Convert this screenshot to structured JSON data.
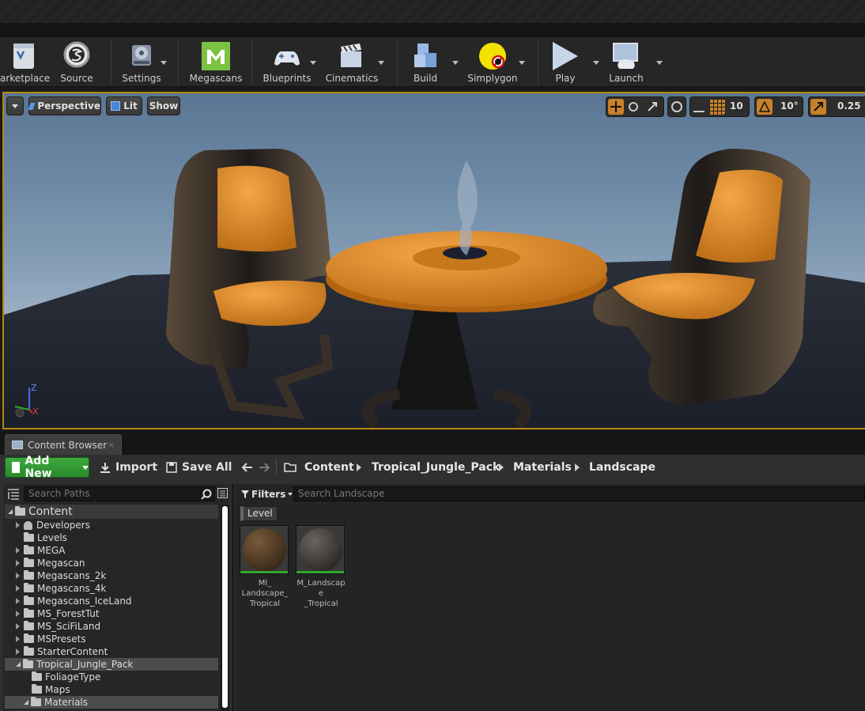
{
  "toolbar": {
    "items": [
      {
        "label": "arketplace",
        "icon": "marketplace-icon"
      },
      {
        "label": "Source",
        "icon": "source-control-icon"
      },
      {
        "label": "Settings",
        "icon": "settings-icon"
      },
      {
        "label": "Megascans",
        "icon": "megascans-icon"
      },
      {
        "label": "Blueprints",
        "icon": "blueprints-icon"
      },
      {
        "label": "Cinematics",
        "icon": "cinematics-icon"
      },
      {
        "label": "Build",
        "icon": "build-icon"
      },
      {
        "label": "Simplygon",
        "icon": "simplygon-icon"
      },
      {
        "label": "Play",
        "icon": "play-icon"
      },
      {
        "label": "Launch",
        "icon": "launch-icon"
      }
    ]
  },
  "viewport": {
    "perspective_label": "Perspective",
    "lit_label": "Lit",
    "show_label": "Show",
    "grid_snap_value": "10",
    "rotation_snap_value": "10°",
    "scale_snap_value": "0.25",
    "axis_labels": {
      "z": "Z",
      "x": "X"
    }
  },
  "content_browser": {
    "tab_label": "Content Browser",
    "tab_close": "×",
    "add_new_label": "Add New",
    "import_label": "Import",
    "save_all_label": "Save All",
    "breadcrumbs": [
      "Content",
      "Tropical_Jungle_Pack",
      "Materials",
      "Landscape"
    ],
    "search_paths_placeholder": "Search Paths",
    "filters_label": "Filters",
    "search_assets_placeholder": "Search Landscape",
    "filter_chip": "Level",
    "tree": [
      {
        "label": "Content",
        "depth": 0,
        "expanded": true,
        "root": true
      },
      {
        "label": "Developers",
        "depth": 1,
        "expanded": false,
        "icon": "user"
      },
      {
        "label": "Levels",
        "depth": 1,
        "expanded": null
      },
      {
        "label": "MEGA",
        "depth": 1,
        "expanded": false
      },
      {
        "label": "Megascan",
        "depth": 1,
        "expanded": false
      },
      {
        "label": "Megascans_2k",
        "depth": 1,
        "expanded": false
      },
      {
        "label": "Megascans_4k",
        "depth": 1,
        "expanded": false
      },
      {
        "label": "Megascans_IceLand",
        "depth": 1,
        "expanded": false
      },
      {
        "label": "MS_ForestTut",
        "depth": 1,
        "expanded": false
      },
      {
        "label": "MS_SciFiLand",
        "depth": 1,
        "expanded": false
      },
      {
        "label": "MSPresets",
        "depth": 1,
        "expanded": false
      },
      {
        "label": "StarterContent",
        "depth": 1,
        "expanded": false
      },
      {
        "label": "Tropical_Jungle_Pack",
        "depth": 1,
        "expanded": true,
        "selected": true
      },
      {
        "label": "FoliageType",
        "depth": 2,
        "expanded": null
      },
      {
        "label": "Maps",
        "depth": 2,
        "expanded": null
      },
      {
        "label": "Materials",
        "depth": 2,
        "expanded": true,
        "selected": true
      }
    ],
    "assets": [
      {
        "name": "MI_\nLandscape_\nTropical",
        "color_a": "#7a5a3a",
        "color_b": "#3a2a1a"
      },
      {
        "name": "M_Landscape\n_Tropical",
        "color_a": "#6a6460",
        "color_b": "#2e2a28"
      }
    ]
  },
  "colors": {
    "viewport_border": "#b8860b",
    "add_new_green": "#2fa82f",
    "snap_active": "#c8812a"
  }
}
